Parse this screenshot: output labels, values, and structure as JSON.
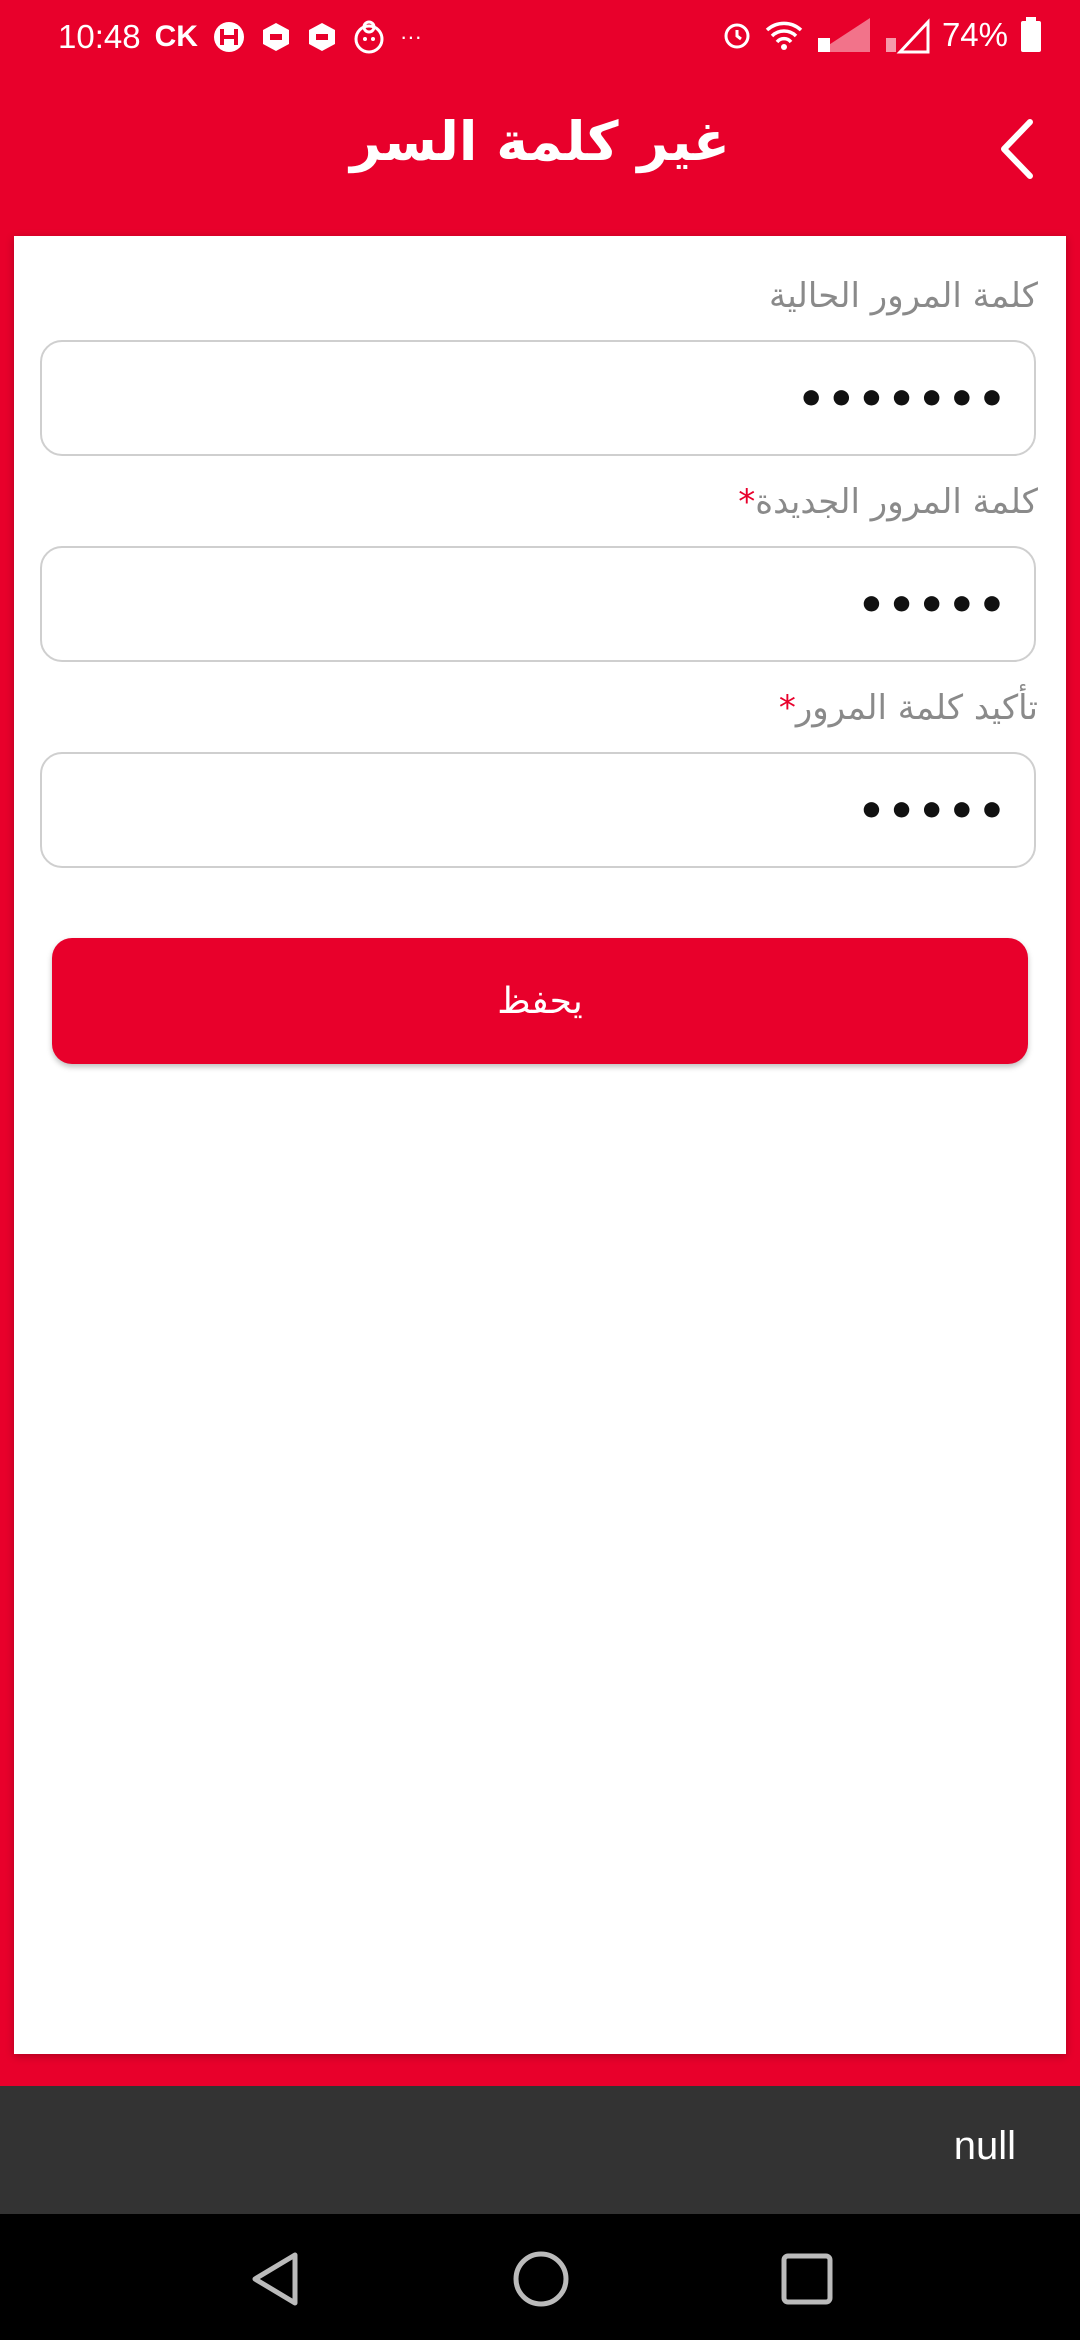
{
  "status_bar": {
    "time": "10:48",
    "carrier": "CK",
    "more": "···",
    "battery": "74%"
  },
  "header": {
    "title": "غير كلمة السر",
    "back_icon": "chevron-left-icon"
  },
  "form": {
    "current_password": {
      "label": "كلمة المرور الحالية",
      "value": "•••••••"
    },
    "new_password": {
      "label": "كلمة المرور الجديدة",
      "required_mark": "*",
      "value": "•••••"
    },
    "confirm_password": {
      "label": "تأكيد كلمة المرور",
      "required_mark": "*",
      "value": "•••••"
    },
    "save_label": "يحفظ"
  },
  "snackbar": {
    "text": "null"
  },
  "colors": {
    "accent": "#e8002b",
    "snackbar": "#333333",
    "navbar": "#000000"
  }
}
